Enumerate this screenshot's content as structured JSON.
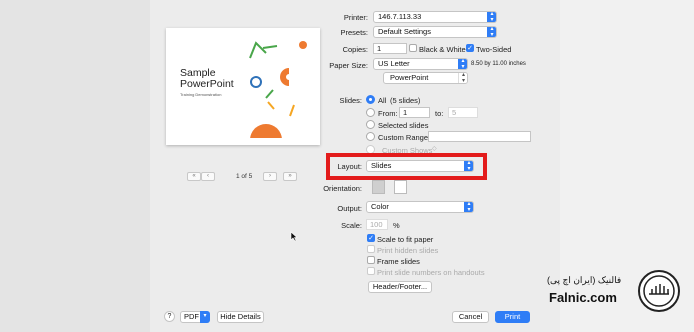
{
  "preview": {
    "slide_title": "Sample PowerPoint",
    "slide_subtitle": "Training Demonstration",
    "page_text": "1 of 5",
    "first_label": "«",
    "prev_label": "‹",
    "next_label": "›",
    "last_label": "»"
  },
  "printer": {
    "label": "Printer:",
    "value": "146.7.113.33"
  },
  "presets": {
    "label": "Presets:",
    "value": "Default Settings"
  },
  "copies": {
    "label": "Copies:",
    "value": "1",
    "bw_label": "Black & White",
    "bw_checked": false,
    "two_sided_label": "Two-Sided",
    "two_sided_checked": true
  },
  "paper": {
    "label": "Paper Size:",
    "value": "US Letter",
    "dims": "8.50 by 11.00 inches"
  },
  "app_menu": {
    "value": "PowerPoint"
  },
  "slides": {
    "label": "Slides:",
    "all_label": "All",
    "all_count": "(5 slides)",
    "from_label": "From:",
    "from_value": "1",
    "to_label": "to:",
    "to_value": "5",
    "selected_label": "Selected slides",
    "range_label": "Custom Range:",
    "custom_shows_label": "Custom Shows"
  },
  "layout": {
    "label": "Layout:",
    "value": "Slides"
  },
  "orientation": {
    "label": "Orientation:"
  },
  "output": {
    "label": "Output:",
    "value": "Color"
  },
  "scale": {
    "label": "Scale:",
    "value": "100",
    "unit": "%"
  },
  "options": {
    "scale_fit_label": "Scale to fit paper",
    "scale_fit_checked": true,
    "print_hidden_label": "Print hidden slides",
    "frame_label": "Frame slides",
    "print_numbers_label": "Print slide numbers on handouts"
  },
  "header_footer_label": "Header/Footer...",
  "footer": {
    "help_label": "?",
    "pdf_label": "PDF",
    "hide_details_label": "Hide Details",
    "cancel_label": "Cancel",
    "print_label": "Print"
  },
  "brand": {
    "name": "Falnic.com",
    "persian": "فالنیک (ایران اچ پی)"
  },
  "colors": {
    "accent": "#2f7df6",
    "highlight": "#e31b1b",
    "slide_orange": "#ee7a30",
    "slide_green": "#49a64a",
    "slide_blue": "#2f72b9"
  }
}
